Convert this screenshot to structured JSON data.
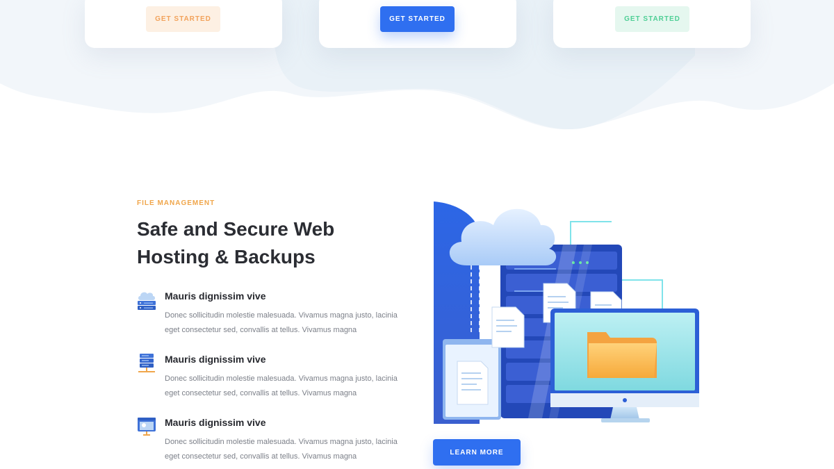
{
  "pricing": {
    "cards": [
      {
        "cta_label": "GET STARTED"
      },
      {
        "cta_label": "GET STARTED"
      },
      {
        "cta_label": "GET STARTED"
      }
    ]
  },
  "section": {
    "eyebrow": "FILE MANAGEMENT",
    "headline": "Safe and Secure Web Hosting & Backups",
    "features": [
      {
        "icon": "cloud-server-icon",
        "title": "Mauris dignissim vive",
        "description": "Donec sollicitudin molestie malesuada. Vivamus magna justo, lacinia eget consectetur sed, convallis at tellus. Vivamus magna"
      },
      {
        "icon": "server-rack-icon",
        "title": "Mauris dignissim vive",
        "description": "Donec sollicitudin molestie malesuada. Vivamus magna justo, lacinia eget consectetur sed, convallis at tellus. Vivamus magna"
      },
      {
        "icon": "browser-window-icon",
        "title": "Mauris dignissim vive",
        "description": "Donec sollicitudin molestie malesuada. Vivamus magna justo, lacinia eget consectetur sed, convallis at tellus. Vivamus magna"
      }
    ],
    "cta_label": "LEARN MORE"
  },
  "colors": {
    "primary": "#2f6ff0",
    "orange": "#f0a64b",
    "green": "#4fcf96",
    "heading": "#2b2d33",
    "body_text": "#7b7f88"
  }
}
